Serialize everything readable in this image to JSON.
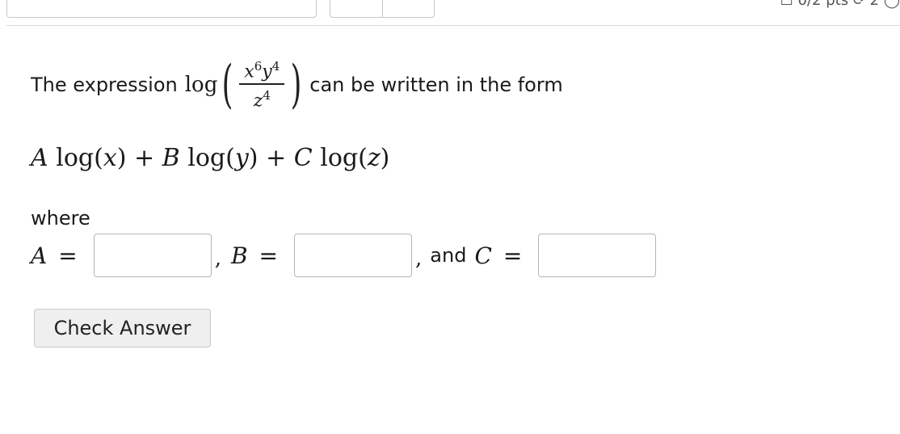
{
  "header": {
    "score_text": "0/2 pts",
    "attempts_text": "2"
  },
  "question": {
    "intro": "The expression",
    "log_word": "log",
    "fraction": {
      "numerator_x": "x",
      "numerator_x_exp": "6",
      "numerator_y": "y",
      "numerator_y_exp": "4",
      "denominator_z": "z",
      "denominator_z_exp": "4"
    },
    "outro": "can be written in the form",
    "form": {
      "a": "A",
      "b": "B",
      "c": "C",
      "log": "log",
      "x": "x",
      "y": "y",
      "z": "z"
    },
    "where": "where"
  },
  "answers": {
    "a_label": "A",
    "b_label": "B",
    "c_label": "C",
    "and_text": "and",
    "equals": "=",
    "comma": ",",
    "a_value": "",
    "b_value": "",
    "c_value": ""
  },
  "check_button_label": "Check Answer"
}
